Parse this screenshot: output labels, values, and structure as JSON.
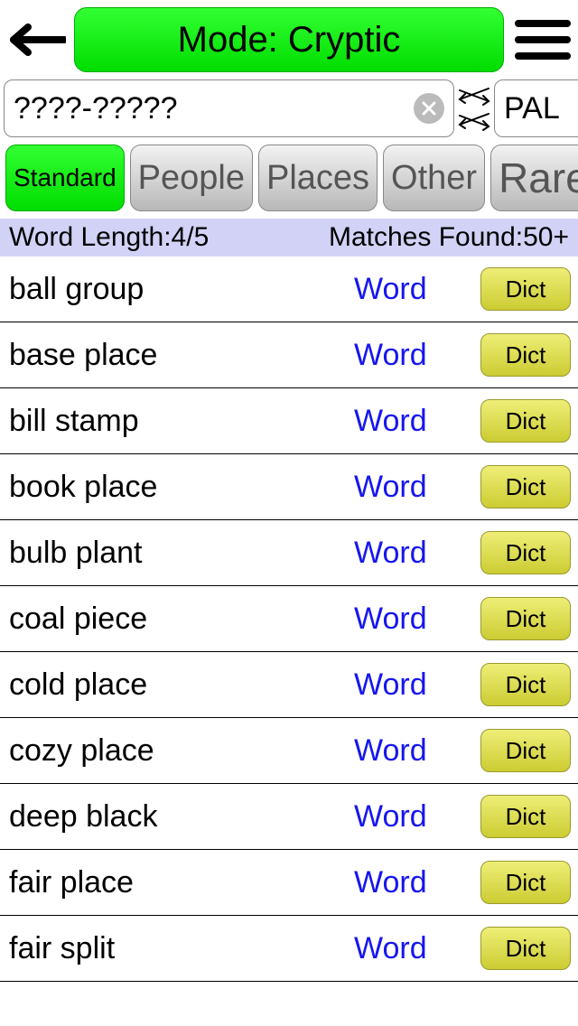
{
  "header": {
    "mode_label": "Mode: Cryptic"
  },
  "inputs": {
    "left_value": "????-?????",
    "right_value": "PAL"
  },
  "filters": {
    "standard": "Standard",
    "people": "People",
    "places": "Places",
    "other": "Other",
    "rare": "Rare"
  },
  "status": {
    "word_length": "Word Length:4/5",
    "matches_found": "Matches Found:50+"
  },
  "type_label": "Word",
  "dict_label": "Dict",
  "results": [
    "ball group",
    "base place",
    "bill stamp",
    "book place",
    "bulb plant",
    "coal piece",
    "cold place",
    "cozy place",
    "deep black",
    "fair place",
    "fair split"
  ]
}
